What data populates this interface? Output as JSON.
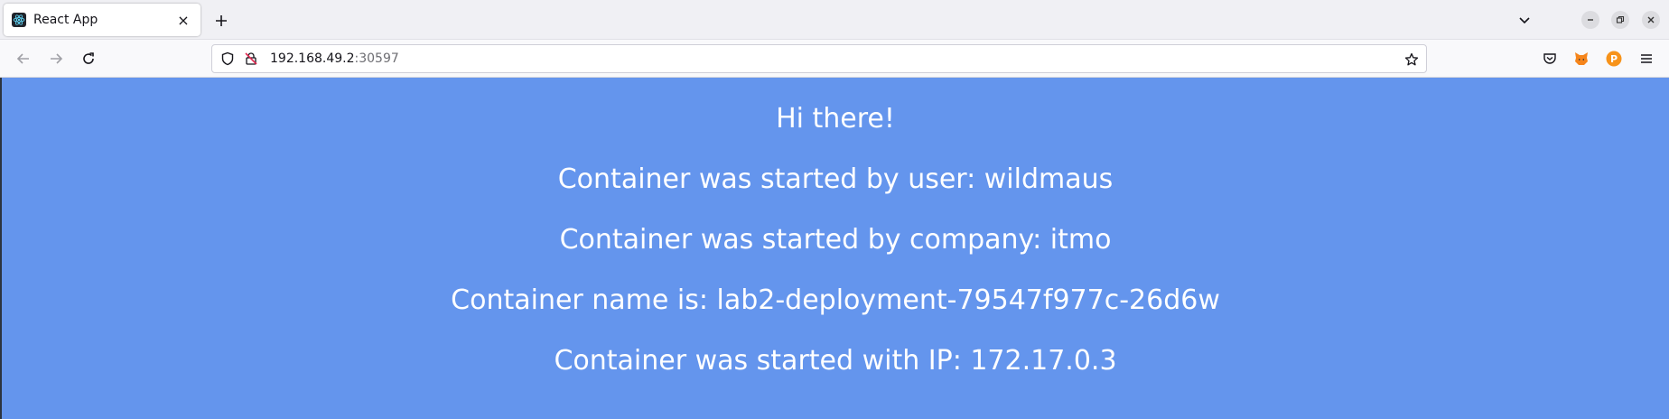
{
  "browser": {
    "tab": {
      "title": "React App",
      "favicon": "react-icon",
      "close": "×"
    },
    "new_tab": "+",
    "url": {
      "host": "192.168.49.2",
      "port": ":30597"
    },
    "icons": {
      "back": "arrow-left-icon",
      "forward": "arrow-right-icon",
      "reload": "reload-icon",
      "shield": "shield-icon",
      "insecure_lock": "insecure-lock-icon",
      "bookmark": "star-icon",
      "pocket": "pocket-icon",
      "metamask": "fox-icon",
      "ext_p": "p-circle-icon",
      "menu": "hamburger-menu-icon"
    },
    "ext_p_label": "P"
  },
  "page": {
    "background": "#6495ed",
    "greeting": "Hi there!",
    "user_line": "Container was started by user: wildmaus",
    "company_line": "Container was started by company: itmo",
    "name_line": "Container name is: lab2-deployment-79547f977c-26d6w",
    "ip_line": "Container was started with IP: 172.17.0.3"
  }
}
